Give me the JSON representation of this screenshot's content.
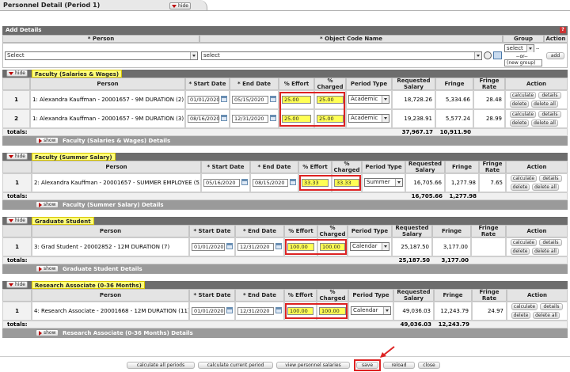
{
  "page": {
    "title": "Personnel Detail (Period 1)",
    "hide_label": "hide",
    "show_label": "show"
  },
  "add": {
    "header": "Add Details",
    "col_person": "* Person",
    "col_object": "* Object Code Name",
    "col_group": "Group",
    "col_action": "Action",
    "person_value": "Select",
    "object_value": "select",
    "group_value": "select",
    "or_text": "--or--",
    "new_group": "(new group)",
    "add_label": "add",
    "dash": "--"
  },
  "cols": {
    "person": "Person",
    "start": "* Start Date",
    "end": "* End Date",
    "effort": "% Effort",
    "charged": "% Charged",
    "ptype": "Period Type",
    "salary": "Requested Salary",
    "fringe": "Fringe",
    "rate": "Fringe Rate",
    "action": "Action"
  },
  "actions": {
    "calculate": "calculate",
    "details": "details",
    "delete": "delete",
    "delete_all": "delete all"
  },
  "totals_label": "totals:",
  "sections": [
    {
      "title": "Faculty (Salaries & Wages)",
      "details": "Faculty (Salaries & Wages) Details",
      "rows": [
        {
          "n": "1",
          "person": "1: Alexandra Kauffman - 20001657 - 9M DURATION (2)",
          "start": "01/01/2020",
          "end": "05/15/2020",
          "effort": "25.00",
          "charged": "25.00",
          "ptype": "Academic",
          "salary": "18,728.26",
          "fringe": "5,334.66",
          "rate": "28.48"
        },
        {
          "n": "2",
          "person": "1: Alexandra Kauffman - 20001657 - 9M DURATION (3)",
          "start": "08/16/2020",
          "end": "12/31/2020",
          "effort": "25.00",
          "charged": "25.00",
          "ptype": "Academic",
          "salary": "19,238.91",
          "fringe": "5,577.24",
          "rate": "28.99"
        }
      ],
      "total_salary": "37,967.17",
      "total_fringe": "10,911.90"
    },
    {
      "title": "Faculty (Summer Salary)",
      "details": "Faculty (Summer Salary) Details",
      "rows": [
        {
          "n": "1",
          "person": "2: Alexandra Kauffman - 20001657 - SUMMER EMPLOYEE (5)",
          "start": "05/16/2020",
          "end": "08/15/2020",
          "effort": "33.33",
          "charged": "33.33",
          "ptype": "Summer",
          "salary": "16,705.66",
          "fringe": "1,277.98",
          "rate": "7.65"
        }
      ],
      "total_salary": "16,705.66",
      "total_fringe": "1,277.98"
    },
    {
      "title": "Graduate Student",
      "details": "Graduate Student Details",
      "rows": [
        {
          "n": "1",
          "person": "3: Grad Student - 20002852 - 12M DURATION (7)",
          "start": "01/01/2020",
          "end": "12/31/2020",
          "effort": "100.00",
          "charged": "100.00",
          "ptype": "Calendar",
          "salary": "25,187.50",
          "fringe": "3,177.00",
          "rate": ""
        }
      ],
      "total_salary": "25,187.50",
      "total_fringe": "3,177.00"
    },
    {
      "title": "Research Associate (0-36 Months)",
      "details": "Research Associate (0-36 Months) Details",
      "rows": [
        {
          "n": "1",
          "person": "4: Research Associate - 20001668 - 12M DURATION (11)",
          "start": "01/01/2020",
          "end": "12/31/2020",
          "effort": "100.00",
          "charged": "100.00",
          "ptype": "Calendar",
          "salary": "49,036.03",
          "fringe": "12,243.79",
          "rate": "24.97"
        }
      ],
      "total_salary": "49,036.03",
      "total_fringe": "12,243.79"
    }
  ],
  "bottom": {
    "calc_all": "calculate all periods",
    "calc_current": "calculate current period",
    "view_salaries": "view personnel salaries",
    "save": "save",
    "reload": "reload",
    "close": "close"
  },
  "colors": {
    "highlight": "#ffff55",
    "annotation": "#dd2222",
    "header_gray": "#6d6d6d"
  }
}
